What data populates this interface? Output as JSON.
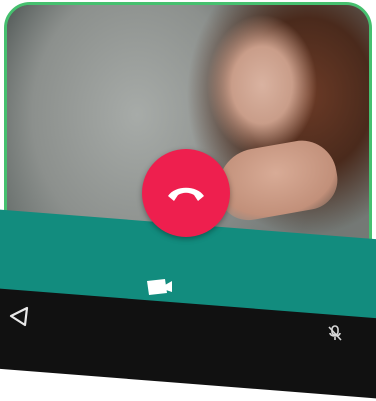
{
  "call_screen": {
    "end_call_icon": "phone-hangup-icon",
    "end_call_color": "#ee1f4e",
    "toolbar_color": "#128c7e",
    "video_icon": "video-camera-icon",
    "mute_icon": "microphone-off-icon",
    "nav_back_icon": "nav-back-triangle-icon",
    "frame_border_color": "#46c06f"
  }
}
